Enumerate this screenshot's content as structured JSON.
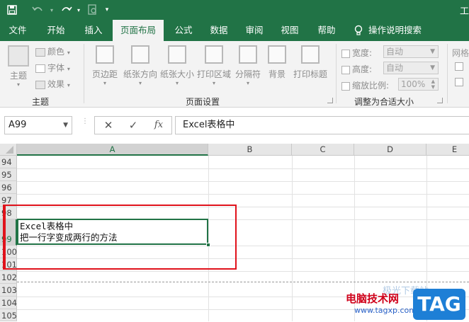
{
  "titlebar": {
    "title_partial": "工"
  },
  "tabs": [
    {
      "label": "文件"
    },
    {
      "label": "开始"
    },
    {
      "label": "插入"
    },
    {
      "label": "页面布局"
    },
    {
      "label": "公式"
    },
    {
      "label": "数据"
    },
    {
      "label": "审阅"
    },
    {
      "label": "视图"
    },
    {
      "label": "帮助"
    }
  ],
  "tellme": {
    "label": "操作说明搜索"
  },
  "ribbon": {
    "theme_group": {
      "label": "主题",
      "themes": "主题",
      "colors": "颜色",
      "fonts": "字体",
      "effects": "效果"
    },
    "page_setup_group": {
      "label": "页面设置",
      "margins": "页边距",
      "orientation": "纸张方向",
      "size": "纸张大小",
      "print_area": "打印区域",
      "breaks": "分隔符",
      "background": "背景",
      "print_titles": "打印标题"
    },
    "scale_group": {
      "label": "调整为合适大小",
      "width_label": "宽度:",
      "width_value": "自动",
      "height_label": "高度:",
      "height_value": "自动",
      "scale_label": "缩放比例:",
      "scale_value": "100%"
    },
    "sheet_options_partial": {
      "gridlines": "网格"
    }
  },
  "formula_bar": {
    "name_box": "A99",
    "cancel": "✕",
    "enter": "✓",
    "fx": "fx",
    "formula": "Excel表格中"
  },
  "grid": {
    "columns": [
      "A",
      "B",
      "C",
      "D",
      "E"
    ],
    "rows": [
      "94",
      "95",
      "96",
      "97",
      "98",
      "99",
      "100",
      "101",
      "102",
      "103",
      "104",
      "105"
    ],
    "cell_a99_line1": "Excel表格中",
    "cell_a99_line2": "把一行字变成两行的方法"
  },
  "watermark": {
    "site": "电脑技术网",
    "url": "www.tagxp.com",
    "tag": "TAG",
    "faint": "极光下载站"
  },
  "colors": {
    "excel_green": "#217346",
    "highlight_red": "#e0121b"
  }
}
